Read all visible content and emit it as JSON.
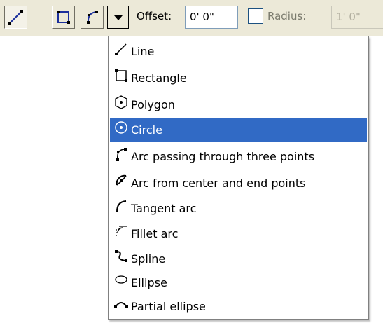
{
  "toolbar": {
    "offset_label": "Offset:",
    "offset_value": "0' 0\"",
    "radius_label": "Radius:",
    "radius_value": "1' 0\""
  },
  "menu": {
    "items": [
      {
        "label": "Line",
        "icon": "line-icon"
      },
      {
        "label": "Rectangle",
        "icon": "rectangle-icon"
      },
      {
        "label": "Polygon",
        "icon": "polygon-icon"
      },
      {
        "label": "Circle",
        "icon": "circle-icon",
        "selected": true
      },
      {
        "label": "Arc passing through three points",
        "icon": "arc-three-points-icon"
      },
      {
        "label": "Arc from center and end points",
        "icon": "arc-center-end-icon"
      },
      {
        "label": "Tangent arc",
        "icon": "tangent-arc-icon"
      },
      {
        "label": "Fillet arc",
        "icon": "fillet-arc-icon"
      },
      {
        "label": "Spline",
        "icon": "spline-icon"
      },
      {
        "label": "Ellipse",
        "icon": "ellipse-icon"
      },
      {
        "label": "Partial ellipse",
        "icon": "partial-ellipse-icon"
      }
    ]
  },
  "colors": {
    "toolbar_bg": "#ece9d8",
    "selection": "#316ac5",
    "field_border": "#7f9db9"
  }
}
